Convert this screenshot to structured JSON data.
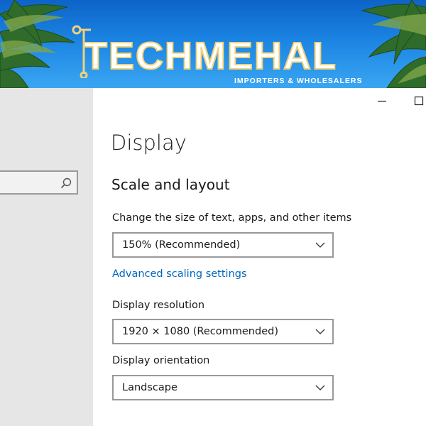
{
  "banner": {
    "brand": "TECHMEHAL",
    "tagline": "IMPORTERS & WHOLESALERS"
  },
  "sidebar": {
    "search": {
      "value": "",
      "placeholder": ""
    }
  },
  "window": {
    "minimize_icon": "minimize-icon",
    "maximize_icon": "maximize-icon"
  },
  "page": {
    "title": "Display",
    "section_title": "Scale and layout",
    "scale": {
      "label": "Change the size of text, apps, and other items",
      "value": "150% (Recommended)"
    },
    "advanced_link": "Advanced scaling settings",
    "resolution": {
      "label": "Display resolution",
      "value": "1920 × 1080 (Recommended)"
    },
    "orientation": {
      "label": "Display orientation",
      "value": "Landscape"
    }
  },
  "colors": {
    "link": "#0067c0",
    "sidebar_bg": "#e6e6e6",
    "banner_sky": "#1b84e2",
    "logo_gold": "#f0d27a"
  }
}
